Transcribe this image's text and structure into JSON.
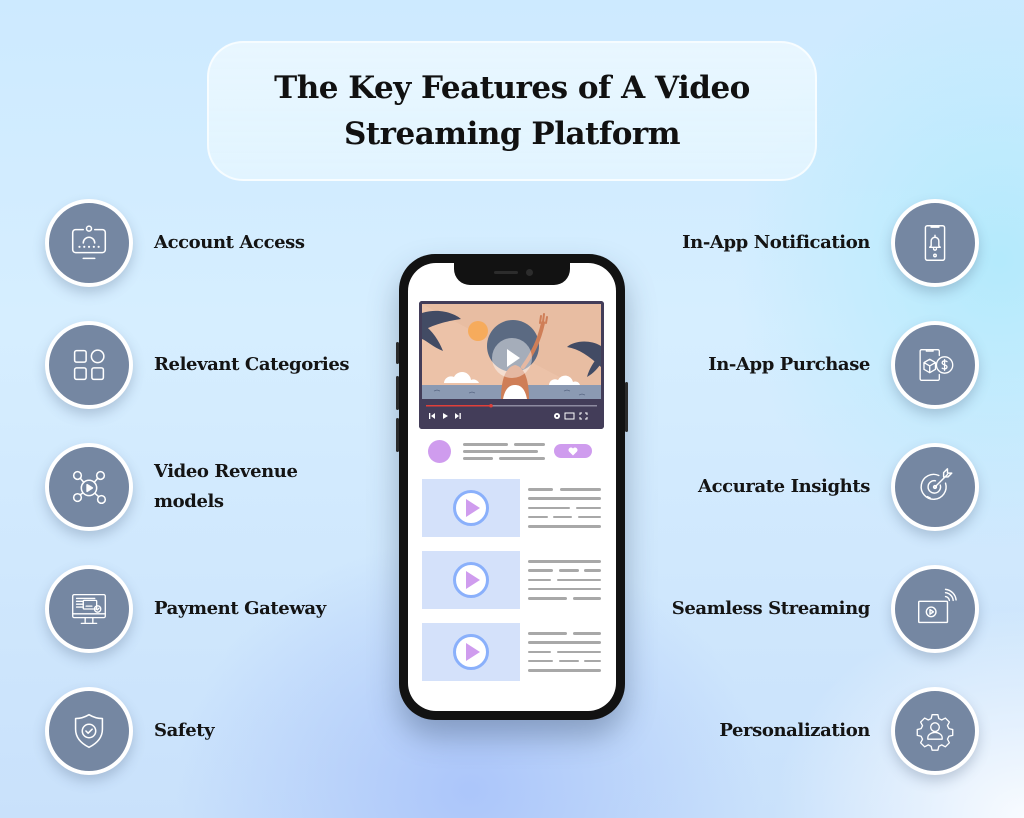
{
  "title": "The Key Features of A Video Streaming Platform",
  "colors": {
    "icon_circle": "#7587a2",
    "accent_purple": "#cf9cee",
    "accent_blue": "#8ab0fb",
    "progress_red": "#e0403a"
  },
  "features_left": [
    {
      "label": "Account Access",
      "icon": "monitor-user-icon"
    },
    {
      "label": "Relevant Categories",
      "icon": "grid-categories-icon"
    },
    {
      "label": "Video Revenue models",
      "icon": "video-network-icon"
    },
    {
      "label": "Payment Gateway",
      "icon": "monitor-payment-icon"
    },
    {
      "label": "Safety",
      "icon": "shield-check-icon"
    }
  ],
  "features_right": [
    {
      "label": "In-App Notification",
      "icon": "phone-bell-icon"
    },
    {
      "label": "In-App Purchase",
      "icon": "phone-box-dollar-icon"
    },
    {
      "label": "Accurate Insights",
      "icon": "target-arrow-icon"
    },
    {
      "label": "Seamless Streaming",
      "icon": "screen-play-wifi-icon"
    },
    {
      "label": "Personalization",
      "icon": "gear-user-icon"
    }
  ],
  "phone": {
    "player_progress": 0.38,
    "video_list_count": 3
  }
}
